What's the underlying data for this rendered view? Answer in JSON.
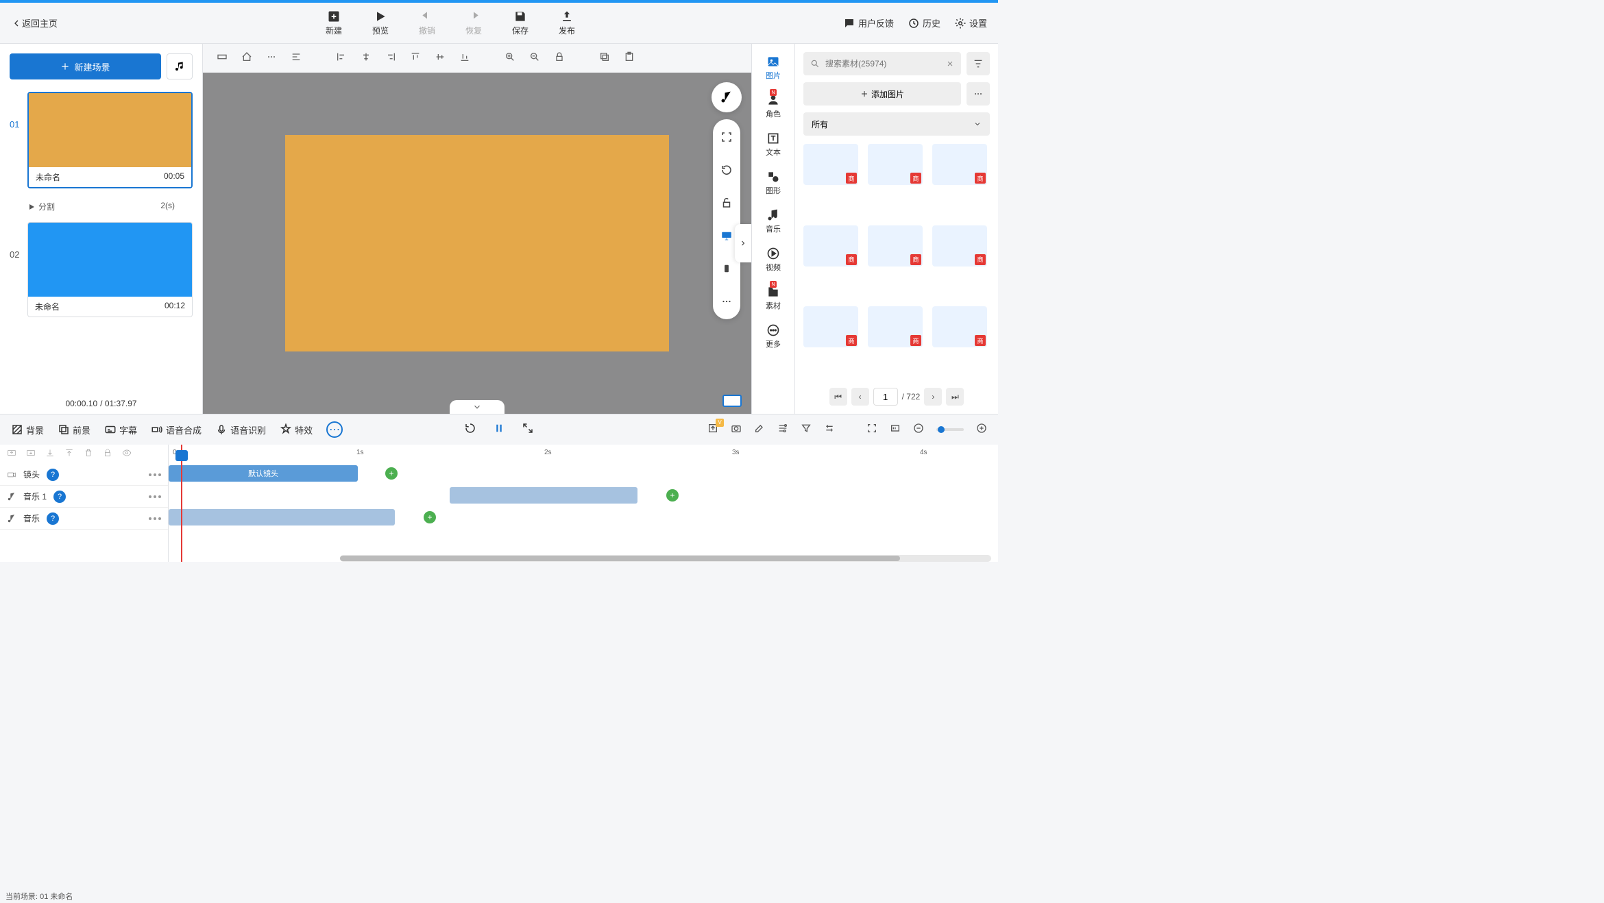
{
  "header": {
    "back": "返回主页",
    "new": "新建",
    "preview": "预览",
    "undo": "撤销",
    "redo": "恢复",
    "save": "保存",
    "publish": "发布",
    "feedback": "用户反馈",
    "history": "历史",
    "settings": "设置"
  },
  "leftPanel": {
    "newScene": "新建场景",
    "scenes": [
      {
        "num": "01",
        "name": "未命名",
        "time": "00:05"
      },
      {
        "num": "02",
        "name": "未命名",
        "time": "00:12"
      }
    ],
    "split": "分割",
    "splitTime": "2(s)",
    "currentTime": "00:00.10",
    "totalTime": "/ 01:37.97"
  },
  "sideTabs": {
    "image": "图片",
    "role": "角色",
    "text": "文本",
    "shape": "图形",
    "music": "音乐",
    "video": "视频",
    "asset": "素材",
    "more": "更多"
  },
  "rightPanel": {
    "searchPlaceholder": "搜索素材(25974)",
    "addImage": "添加图片",
    "category": "所有",
    "cornerLabel": "商",
    "page": "1",
    "totalPages": "/ 722"
  },
  "bottom": {
    "bg": "背景",
    "fg": "前景",
    "subtitle": "字幕",
    "tts": "语音合成",
    "asr": "语音识别",
    "fx": "特效",
    "tracks": {
      "camera": "镜头",
      "music1": "音乐 1",
      "music": "音乐",
      "defaultCam": "默认镜头"
    },
    "status": "当前场景: 01   未命名",
    "ruler": [
      "0s",
      "1s",
      "2s",
      "3s",
      "4s"
    ]
  }
}
